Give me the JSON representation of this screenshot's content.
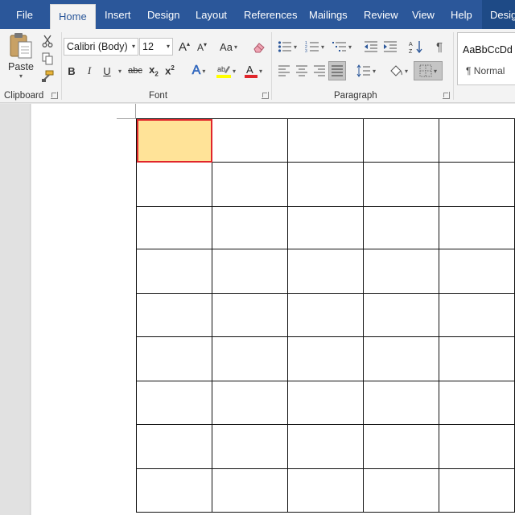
{
  "tabs": [
    {
      "label": "File",
      "active": false
    },
    {
      "label": "Home",
      "active": true
    },
    {
      "label": "Insert",
      "active": false
    },
    {
      "label": "Design",
      "active": false
    },
    {
      "label": "Layout",
      "active": false
    },
    {
      "label": "References",
      "active": false
    },
    {
      "label": "Mailings",
      "active": false
    },
    {
      "label": "Review",
      "active": false
    },
    {
      "label": "View",
      "active": false
    },
    {
      "label": "Help",
      "active": false
    },
    {
      "label": "Desig",
      "active": false,
      "contextual": true
    }
  ],
  "clipboard": {
    "paste_label": "Paste",
    "group_label": "Clipboard"
  },
  "font": {
    "font_name": "Calibri (Body)",
    "font_size": "12",
    "group_label": "Font",
    "bold": "B",
    "italic": "I",
    "underline": "U",
    "strike": "abc",
    "change_case": "Aa",
    "highlight_color": "#ffff00",
    "font_color": "#e0262b"
  },
  "paragraph": {
    "group_label": "Paragraph",
    "pilcrow": "¶"
  },
  "styles": {
    "sample": "AaBbCcDd",
    "name": "¶ Normal"
  },
  "document": {
    "rows": 9,
    "columns": 5,
    "selected_cell": {
      "row": 1,
      "col": 1
    },
    "selected_fill": "#ffe398",
    "selected_outline": "#e0262b"
  },
  "colors": {
    "title_bar": "#2b579a",
    "ribbon_bg": "#f3f3f3"
  }
}
